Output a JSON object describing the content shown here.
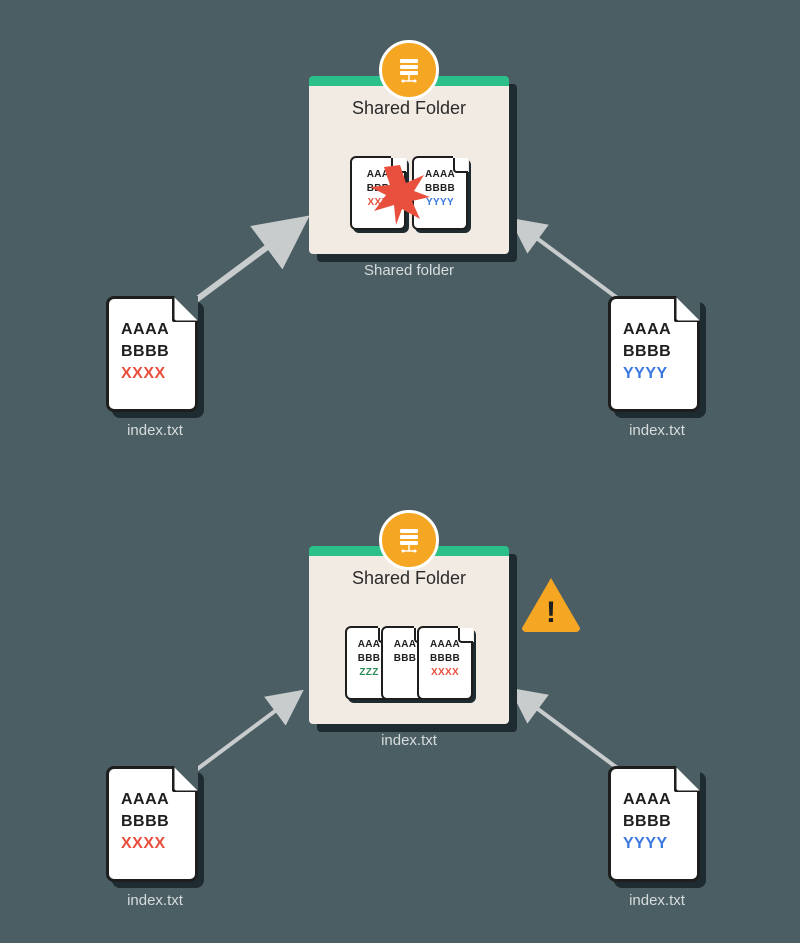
{
  "scene_top": {
    "folder": {
      "title": "Shared Folder",
      "caption": "Shared folder",
      "minidocs": [
        {
          "l1": "AAA",
          "l2": "BBB",
          "l3": "XXX",
          "l3color": "red"
        },
        {
          "l1": "AAAA",
          "l2": "BBBB",
          "l3": "YYYY",
          "l3color": "blue"
        }
      ]
    },
    "doc_left": {
      "l1": "AAAA",
      "l2": "BBBB",
      "l3": "XXXX",
      "l3color": "red",
      "label": "index.txt"
    },
    "doc_right": {
      "l1": "AAAA",
      "l2": "BBBB",
      "l3": "YYYY",
      "l3color": "blue",
      "label": "index.txt"
    }
  },
  "scene_bottom": {
    "folder": {
      "title": "Shared Folder",
      "caption": "index.txt",
      "minidocs": [
        {
          "l1": "AAA",
          "l2": "BBB",
          "l3": "ZZZ",
          "l3color": "green"
        },
        {
          "l1": "AAA",
          "l2": "BBB",
          "l3": "",
          "l3color": ""
        },
        {
          "l1": "AAAA",
          "l2": "BBBB",
          "l3": "XXXX",
          "l3color": "red"
        }
      ]
    },
    "doc_left": {
      "l1": "AAAA",
      "l2": "BBBB",
      "l3": "XXXX",
      "l3color": "red",
      "label": "index.txt"
    },
    "doc_right": {
      "l1": "AAAA",
      "l2": "BBBB",
      "l3": "YYYY",
      "l3color": "blue",
      "label": "index.txt"
    },
    "warning": "!"
  }
}
